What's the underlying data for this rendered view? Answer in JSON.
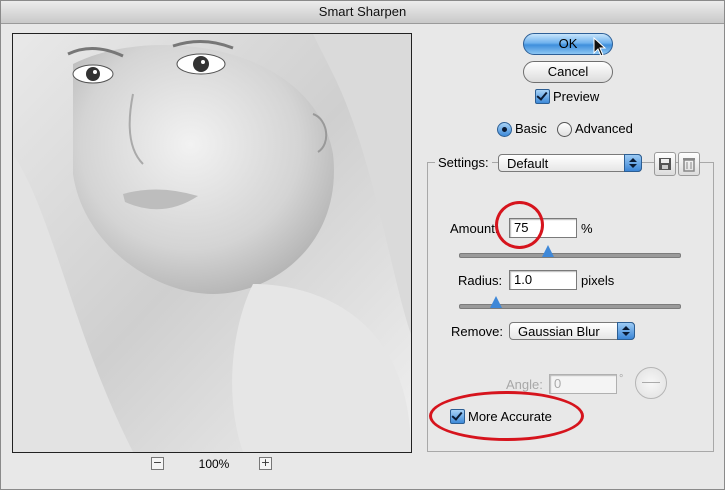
{
  "window": {
    "title": "Smart Sharpen"
  },
  "preview": {
    "zoom_out": "−",
    "zoom_level": "100%",
    "zoom_in": "+"
  },
  "buttons": {
    "ok": "OK",
    "cancel": "Cancel"
  },
  "preview_option": {
    "label": "Preview",
    "checked": true
  },
  "mode": {
    "basic": "Basic",
    "advanced": "Advanced",
    "selected": "basic"
  },
  "settings": {
    "label": "Settings:",
    "value": "Default",
    "save_icon": "floppy-disk-icon",
    "delete_icon": "trash-icon"
  },
  "amount": {
    "label": "Amount:",
    "value": "75",
    "unit": "%",
    "slider_fraction": 0.375
  },
  "radius": {
    "label": "Radius:",
    "value": "1.0",
    "unit": "pixels",
    "slider_fraction": 0.17
  },
  "remove": {
    "label": "Remove:",
    "value": "Gaussian Blur"
  },
  "angle": {
    "label": "Angle:",
    "value": "0",
    "unit": "°"
  },
  "more_accurate": {
    "label": "More Accurate",
    "checked": true
  },
  "colors": {
    "annotation": "#d6141d",
    "accent": "#3f88d8"
  }
}
